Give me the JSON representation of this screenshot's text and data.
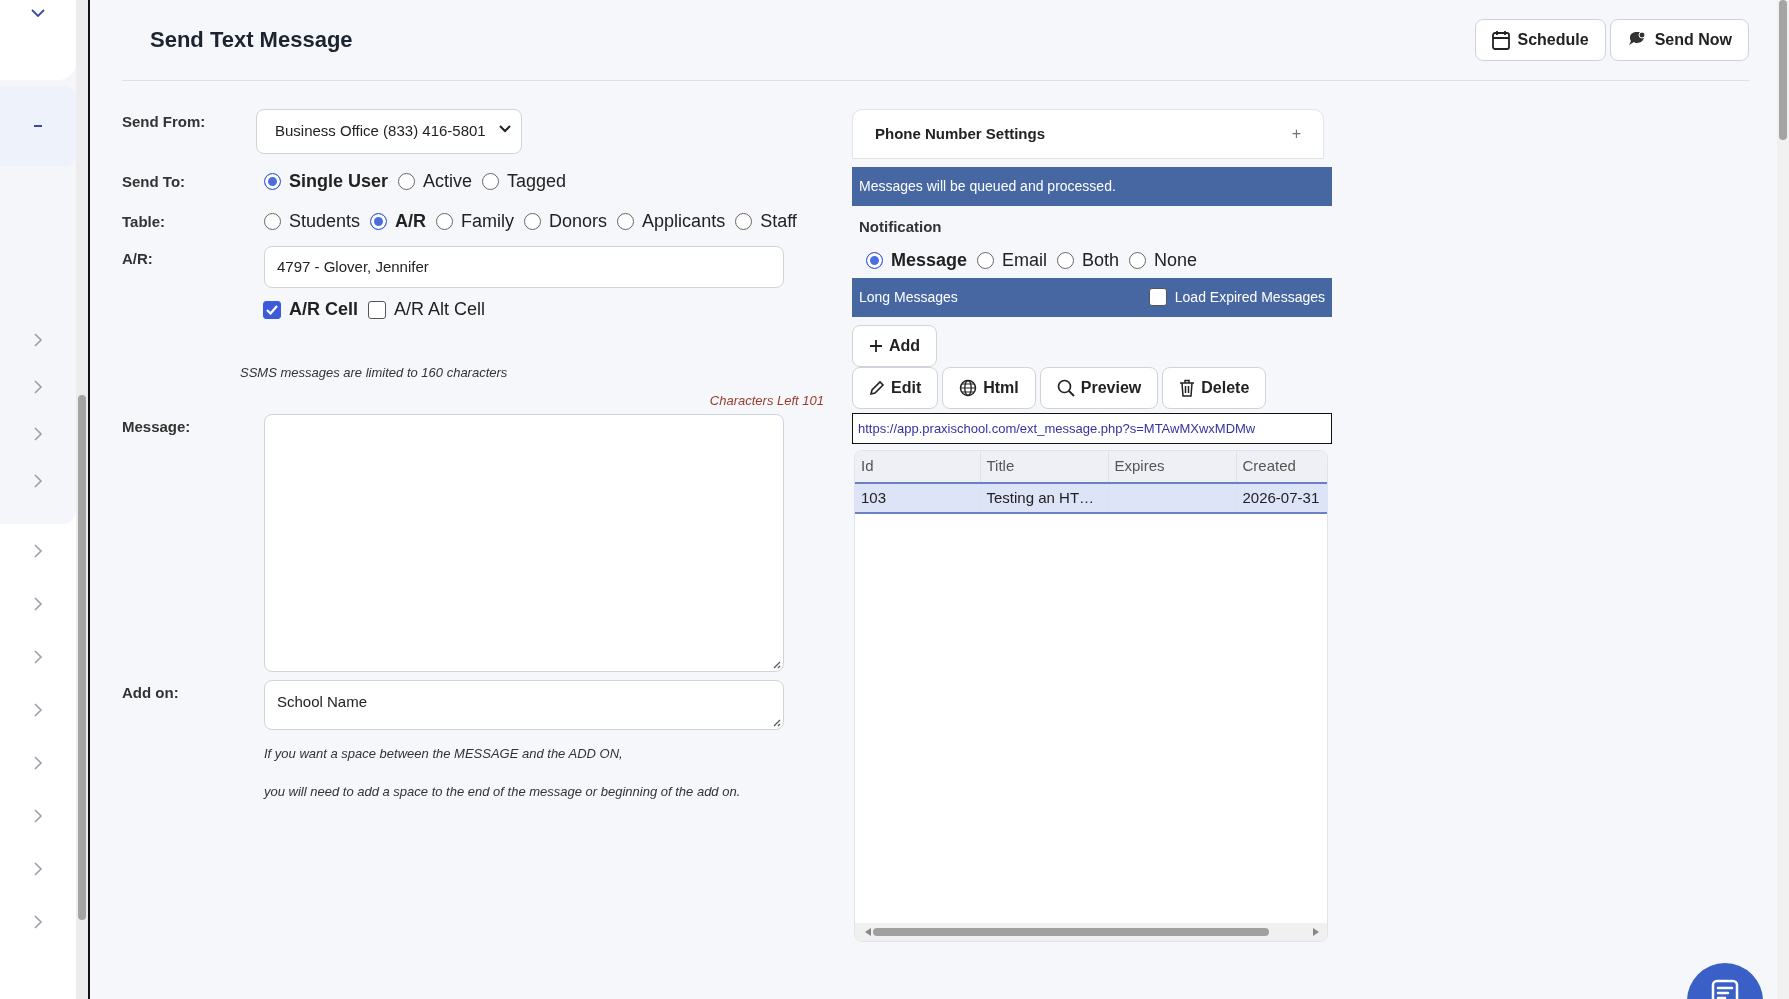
{
  "sidebar": {
    "sections": [
      {
        "panel": true,
        "items": [
          {
            "kind": "toggle",
            "expanded": true
          },
          {
            "kind": "dash",
            "selected": true
          },
          {
            "kind": "toggle",
            "expanded": false
          },
          {
            "kind": "toggle",
            "expanded": false
          },
          {
            "kind": "toggle",
            "expanded": false
          },
          {
            "kind": "toggle",
            "expanded": false
          }
        ]
      },
      {
        "panel": false,
        "items": [
          {
            "kind": "toggle",
            "expanded": false
          },
          {
            "kind": "toggle",
            "expanded": false
          },
          {
            "kind": "toggle",
            "expanded": false
          },
          {
            "kind": "toggle",
            "expanded": false
          },
          {
            "kind": "toggle",
            "expanded": false
          },
          {
            "kind": "toggle",
            "expanded": false
          },
          {
            "kind": "toggle",
            "expanded": false
          },
          {
            "kind": "toggle",
            "expanded": false
          }
        ]
      }
    ]
  },
  "header": {
    "title": "Send Text Message",
    "actions": [
      {
        "label": "Schedule",
        "kind": "calendar"
      },
      {
        "label": "Send Now",
        "kind": "send"
      }
    ]
  },
  "form": {
    "send_from": {
      "label": "Send From:",
      "value": "Business Office (833) 416-5801"
    },
    "send_to": {
      "label": "Send To:",
      "options": [
        {
          "label": "Single User",
          "selected": true
        },
        {
          "label": "Active",
          "selected": false
        },
        {
          "label": "Tagged",
          "selected": false
        }
      ]
    },
    "table": {
      "label": "Table:",
      "options": [
        {
          "label": "Students",
          "selected": false
        },
        {
          "label": "A/R",
          "selected": true
        },
        {
          "label": "Family",
          "selected": false
        },
        {
          "label": "Donors",
          "selected": false
        },
        {
          "label": "Applicants",
          "selected": false
        },
        {
          "label": "Staff",
          "selected": false
        }
      ]
    },
    "recipient": {
      "label": "A/R:",
      "value": "4797 - Glover, Jennifer"
    },
    "phones": [
      {
        "label": "A/R Cell",
        "checked": true
      },
      {
        "label": "A/R Alt Cell",
        "checked": false
      }
    ],
    "limit_note": "SSMS messages are limited to 160 characters",
    "chars_left": "Characters Left 101",
    "message": {
      "label": "Message:"
    },
    "add_on": {
      "label": "Add on:",
      "value": "School Name"
    },
    "notes": [
      "If you want a space between the MESSAGE and the ADD ON,",
      "you will need to add a space to the end of the message or beginning of the add on."
    ]
  },
  "panel": {
    "phone_settings": {
      "title": "Phone Number Settings",
      "toggle": "+"
    },
    "info": "Messages will be queued and processed.",
    "notification": {
      "label": "Notification",
      "options": [
        {
          "label": "Message",
          "selected": true
        },
        {
          "label": "Email",
          "selected": false
        },
        {
          "label": "Both",
          "selected": false
        },
        {
          "label": "None",
          "selected": false
        }
      ]
    },
    "long_messages": {
      "title": "Long Messages",
      "load_expired": {
        "label": "Load Expired Messages",
        "checked": false
      }
    },
    "add_button": {
      "label": "Add",
      "kind": "plus"
    },
    "buttons": [
      {
        "label": "Edit",
        "kind": "pencil"
      },
      {
        "label": "Html",
        "kind": "globe"
      },
      {
        "label": "Preview",
        "kind": "search"
      },
      {
        "label": "Delete",
        "kind": "trash"
      }
    ],
    "url": "https://app.praxischool.com/ext_message.php?s=MTAwMXwxMDMw",
    "table": {
      "columns": [
        "Id",
        "Title",
        "Expires",
        "Created"
      ],
      "rows": [
        {
          "cells": [
            "103",
            "Testing an HT…",
            "",
            "2026-07-31"
          ],
          "selected": true
        }
      ]
    }
  }
}
